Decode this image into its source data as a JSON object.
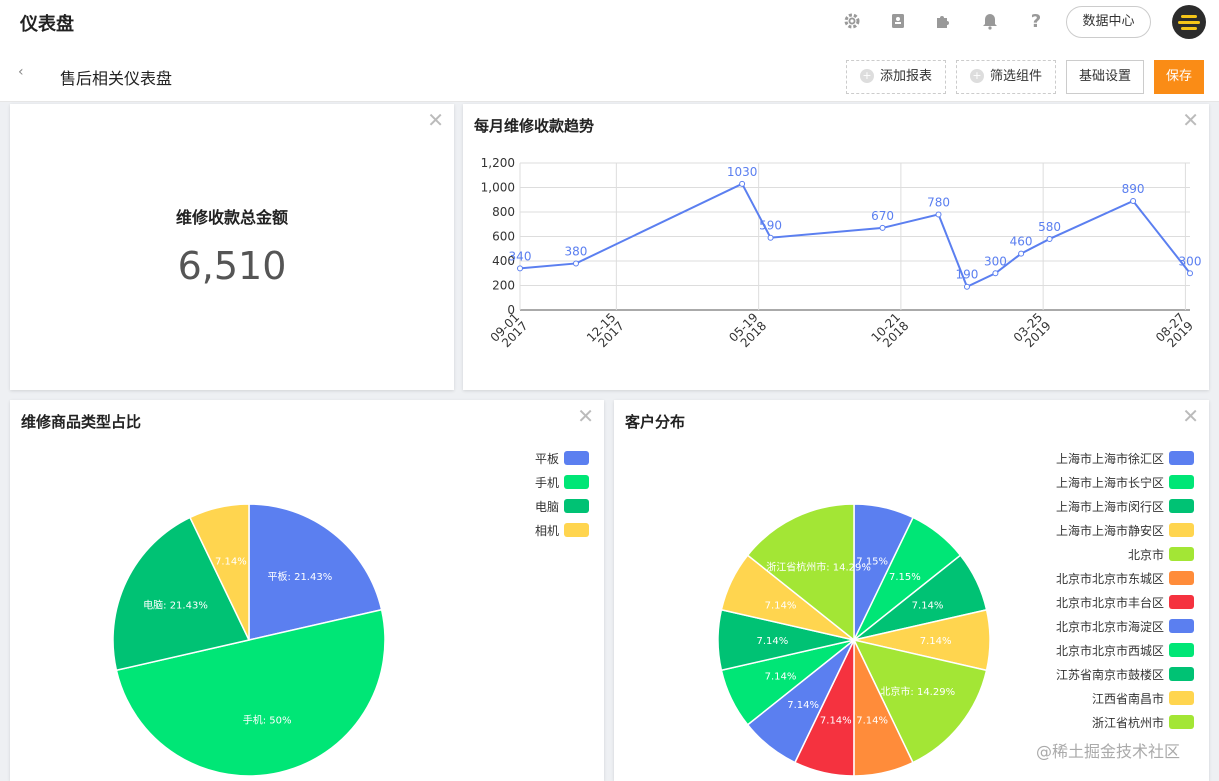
{
  "app": {
    "title": "仪表盘"
  },
  "topbar": {
    "icons": [
      "gear-icon",
      "contacts-icon",
      "puzzle-icon",
      "bell-icon",
      "help-icon"
    ],
    "data_center_label": "数据中心"
  },
  "subbar": {
    "title": "售后相关仪表盘",
    "add_report_label": "添加报表",
    "filter_widget_label": "筛选组件",
    "basic_settings_label": "基础设置",
    "save_label": "保存",
    "save_color": "#fa8c16"
  },
  "kpi": {
    "label": "维修收款总金额",
    "value": "6,510"
  },
  "line_card": {
    "title": "每月维修收款趋势"
  },
  "product_card": {
    "title": "维修商品类型占比"
  },
  "customer_card": {
    "title": "客户分布"
  },
  "watermark": "@稀土掘金技术社区",
  "chart_data": [
    {
      "type": "line",
      "title": "每月维修收款趋势",
      "x": [
        "2017-09-01",
        "2017-11-01",
        "2018-05-01",
        "2018-06-01",
        "2018-10-01",
        "2018-12-01",
        "2019-01-01",
        "2019-02-01",
        "2019-03-01",
        "2019-04-01",
        "2019-07-01",
        "2019-09-01"
      ],
      "series": [
        {
          "values": [
            340,
            380,
            1030,
            590,
            670,
            780,
            190,
            300,
            460,
            580,
            890,
            300
          ]
        }
      ],
      "y_ticks": [
        "0",
        "200",
        "400",
        "600",
        "800",
        "1,000",
        "1,200"
      ],
      "x_ticks": [
        {
          "date": "2017-09-01",
          "line1": "09-01",
          "line2": "2017"
        },
        {
          "date": "2017-12-15",
          "line1": "12-15",
          "line2": "2017"
        },
        {
          "date": "2018-05-19",
          "line1": "05-19",
          "line2": "2018"
        },
        {
          "date": "2018-10-21",
          "line1": "10-21",
          "line2": "2018"
        },
        {
          "date": "2019-03-25",
          "line1": "03-25",
          "line2": "2019"
        },
        {
          "date": "2019-08-27",
          "line1": "08-27",
          "line2": "2019"
        }
      ],
      "ylim": [
        0,
        1200
      ],
      "xlim": [
        "2017-09-01",
        "2019-09-01"
      ],
      "grid": true,
      "color": "#5b7ff0"
    },
    {
      "type": "pie",
      "title": "维修商品类型占比",
      "categories": [
        "平板",
        "手机",
        "电脑",
        "相机"
      ],
      "values": [
        21.43,
        50,
        21.43,
        7.14
      ],
      "labels": [
        "平板: 21.43%",
        "手机: 50%",
        "电脑: 21.43%",
        "7.14%"
      ],
      "colors": [
        "#5b7ff0",
        "#00e676",
        "#00c274",
        "#ffd54f"
      ],
      "legend": "top-right"
    },
    {
      "type": "pie",
      "title": "客户分布",
      "categories": [
        "上海市上海市徐汇区",
        "上海市上海市长宁区",
        "上海市上海市闵行区",
        "上海市上海市静安区",
        "北京市",
        "北京市北京市东城区",
        "北京市北京市丰台区",
        "北京市北京市海淀区",
        "北京市北京市西城区",
        "江苏省南京市鼓楼区",
        "江西省南昌市",
        "浙江省杭州市"
      ],
      "values": [
        7.15,
        7.15,
        7.14,
        7.14,
        14.29,
        7.14,
        7.14,
        7.14,
        7.14,
        7.14,
        7.14,
        14.29
      ],
      "labels": [
        "7.15%",
        "7.15%",
        "7.14%",
        "7.14%",
        "北京市: 14.29%",
        "7.14%",
        "7.14%",
        "7.14%",
        "7.14%",
        "7.14%",
        "7.14%",
        "浙江省杭州市: 14.29%"
      ],
      "colors": [
        "#5b7ff0",
        "#00e676",
        "#00c274",
        "#ffd54f",
        "#a3e635",
        "#ff8c3a",
        "#f5323f",
        "#5b7ff0",
        "#00e676",
        "#00c274",
        "#ffd54f",
        "#a3e635"
      ],
      "legend": "top-right"
    }
  ]
}
